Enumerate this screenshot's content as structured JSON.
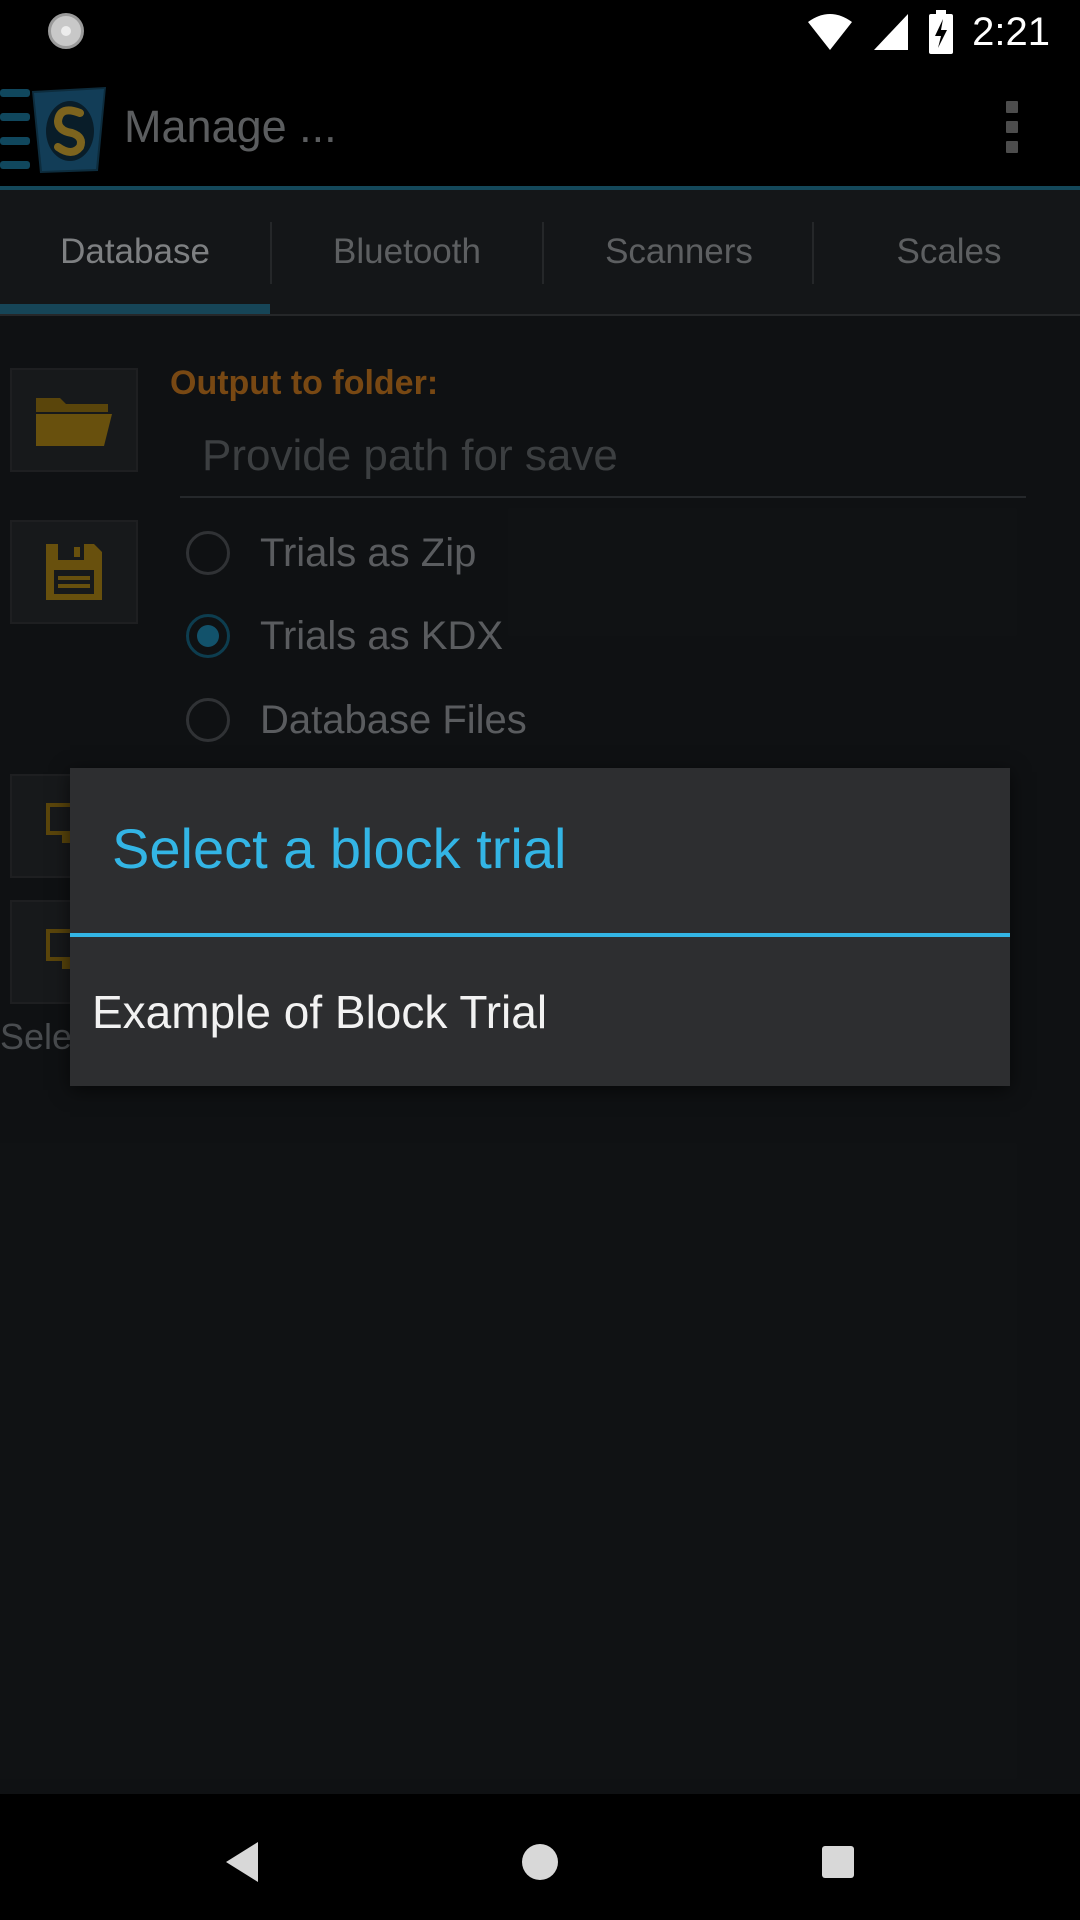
{
  "status_bar": {
    "time": "2:21"
  },
  "app_bar": {
    "title": "Manage ...",
    "accent_color": "#1f6f8b"
  },
  "tabs": [
    {
      "label": "Database",
      "active": true
    },
    {
      "label": "Bluetooth",
      "active": false
    },
    {
      "label": "Scanners",
      "active": false
    },
    {
      "label": "Scales",
      "active": false
    }
  ],
  "database_panel": {
    "output_label": "Output to folder:",
    "path_placeholder": "Provide path for save",
    "path_value": "",
    "options": [
      {
        "label": "Trials as Zip",
        "checked": false
      },
      {
        "label": "Trials as KDX",
        "checked": true
      },
      {
        "label": "Database Files",
        "checked": false
      }
    ],
    "partial_label": "Sele"
  },
  "dialog": {
    "title": "Select a block trial",
    "items": [
      "Example of Block Trial"
    ],
    "accent_color": "#33b5e5"
  },
  "icons": {
    "folder": "folder-icon",
    "save": "floppy-disk-icon",
    "wifi": "wifi-icon",
    "signal": "cell-signal-icon",
    "battery": "battery-charging-icon",
    "back": "back-icon",
    "home": "home-icon",
    "recents": "recents-icon"
  }
}
